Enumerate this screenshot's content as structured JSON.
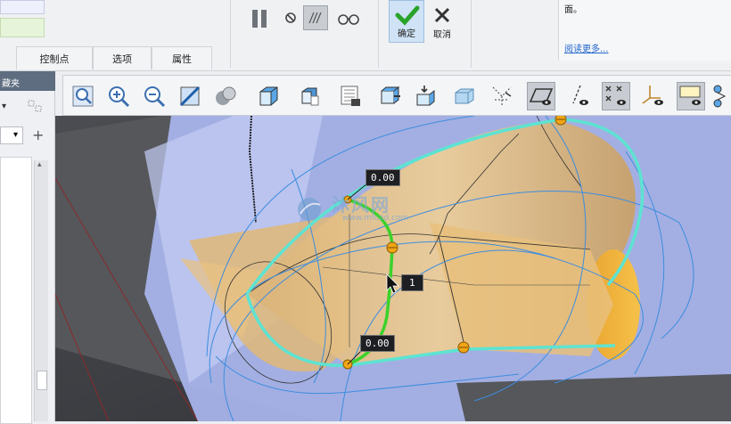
{
  "ribbon": {
    "tabs": [
      "控制点",
      "选项",
      "属性"
    ],
    "confirm_label": "确定",
    "cancel_label": "取消"
  },
  "help": {
    "text": "面。",
    "link": "阅读更多..."
  },
  "left_panel": {
    "header": "藏夹"
  },
  "viewport": {
    "label_top": "0.00",
    "label_mid": "1",
    "label_bottom": "0.00",
    "watermark_text": "沐风网",
    "watermark_url": "www.mfcad.com"
  },
  "colors": {
    "boundary": "#5de3d2",
    "selected_curve": "#3bd22a",
    "control_point": "#f2a516",
    "surface": "#e7bf78",
    "plane": "#aab6ee"
  },
  "icons": [
    "zoom-window-icon",
    "zoom-in-icon",
    "zoom-out-icon",
    "refit-icon",
    "shading-icon",
    "view-orient-icon",
    "saved-views-icon",
    "display-style-icon",
    "named-views-icon",
    "pan-icon",
    "spin-center-icon",
    "perspective-icon",
    "datum-display-icon",
    "plane-display-icon",
    "axis-display-icon",
    "point-display-icon",
    "csys-display-icon",
    "annotation-display-icon",
    "spin-icon"
  ]
}
